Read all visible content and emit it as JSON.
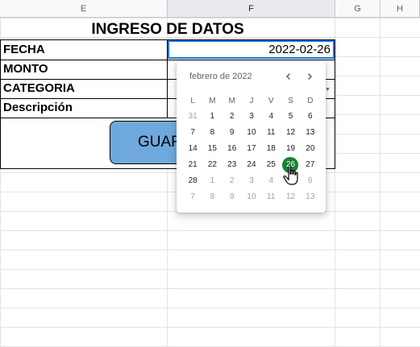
{
  "column_headers": [
    "E",
    "F",
    "G",
    "H"
  ],
  "form": {
    "title": "INGRESO DE DATOS",
    "labels": [
      "FECHA",
      "MONTO",
      "CATEGORIA",
      "Descripción"
    ],
    "fecha_value": "2022-02-26",
    "save_button": "GUARDAR"
  },
  "calendar": {
    "month_label": "febrero de 2022",
    "weekdays": [
      "L",
      "M",
      "M",
      "J",
      "V",
      "S",
      "D"
    ],
    "weeks": [
      [
        "31",
        "1",
        "2",
        "3",
        "4",
        "5",
        "6"
      ],
      [
        "7",
        "8",
        "9",
        "10",
        "11",
        "12",
        "13"
      ],
      [
        "14",
        "15",
        "16",
        "17",
        "18",
        "19",
        "20"
      ],
      [
        "21",
        "22",
        "23",
        "24",
        "25",
        "26",
        "27"
      ],
      [
        "28",
        "1",
        "2",
        "3",
        "4",
        "5",
        "6"
      ],
      [
        "7",
        "8",
        "9",
        "10",
        "11",
        "12",
        "13"
      ]
    ],
    "selected_day": "26",
    "selected_color": "#188038",
    "prev_icon": "chevron-left-icon",
    "next_icon": "chevron-right-icon"
  },
  "colors": {
    "selection_border": "#1a73e8",
    "button_fill": "#6fa8dc"
  }
}
